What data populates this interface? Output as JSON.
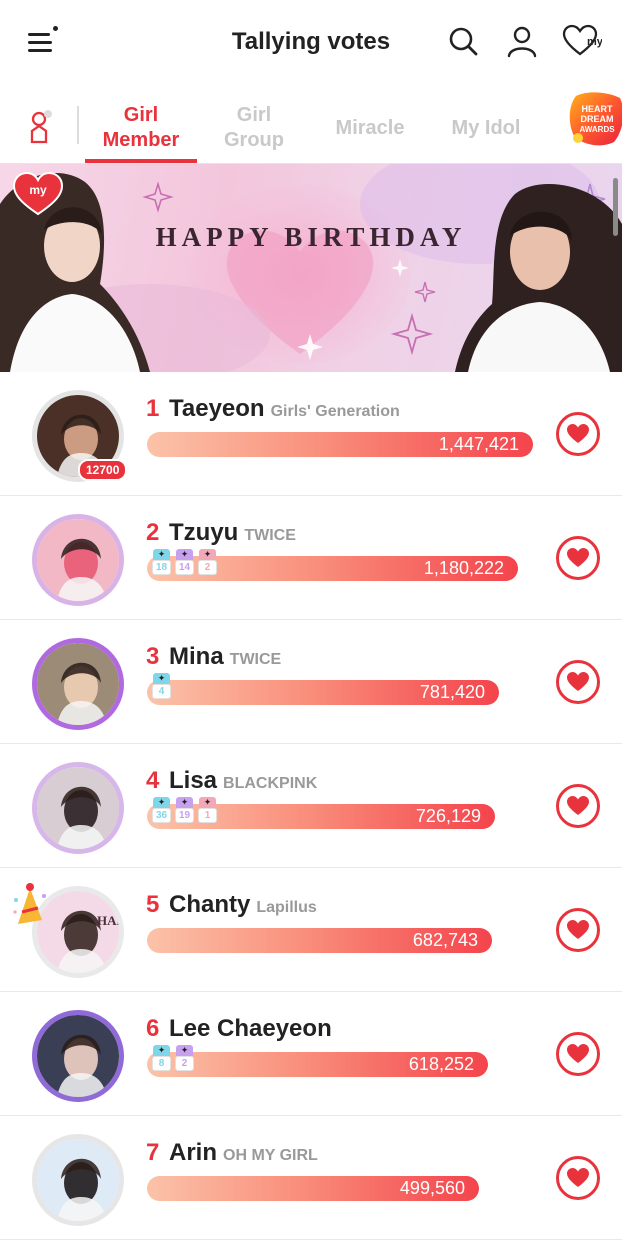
{
  "header": {
    "title": "Tallying votes",
    "icons": [
      "menu-icon",
      "search-icon",
      "profile-icon",
      "my-heart-icon"
    ],
    "my_label": "my"
  },
  "tabs": [
    {
      "label": "Girl\nMember",
      "active": true
    },
    {
      "label": "Girl\nGroup",
      "active": false
    },
    {
      "label": "Miracle",
      "active": false
    },
    {
      "label": "My Idol",
      "active": false
    }
  ],
  "award_badge": {
    "lines": [
      "HEART",
      "DREAM",
      "AWARDS"
    ]
  },
  "banner": {
    "title": "HAPPY BIRTHDAY",
    "my_label": "my"
  },
  "accent": "#e8323c",
  "rankings": [
    {
      "rank": "1",
      "name": "Taeyeon",
      "group": "Girls' Generation",
      "votes": "1,447,421",
      "fill": 1.0,
      "count": "12700",
      "badges": []
    },
    {
      "rank": "2",
      "name": "Tzuyu",
      "group": "TWICE",
      "votes": "1,180,222",
      "fill": 0.962,
      "badges": [
        "18",
        "14",
        "2"
      ]
    },
    {
      "rank": "3",
      "name": "Mina",
      "group": "TWICE",
      "votes": "781,420",
      "fill": 0.913,
      "badges": [
        "4"
      ]
    },
    {
      "rank": "4",
      "name": "Lisa",
      "group": "BLACKPINK",
      "votes": "726,129",
      "fill": 0.902,
      "badges": [
        "36",
        "19",
        "1"
      ]
    },
    {
      "rank": "5",
      "name": "Chanty",
      "group": "Lapillus",
      "votes": "682,743",
      "fill": 0.894,
      "badges": [],
      "avatar_text": "HAP"
    },
    {
      "rank": "6",
      "name": "Lee Chaeyeon",
      "group": "",
      "votes": "618,252",
      "fill": 0.883,
      "badges": [
        "8",
        "2"
      ]
    },
    {
      "rank": "7",
      "name": "Arin",
      "group": "OH MY GIRL",
      "votes": "499,560",
      "fill": 0.86,
      "badges": []
    }
  ]
}
